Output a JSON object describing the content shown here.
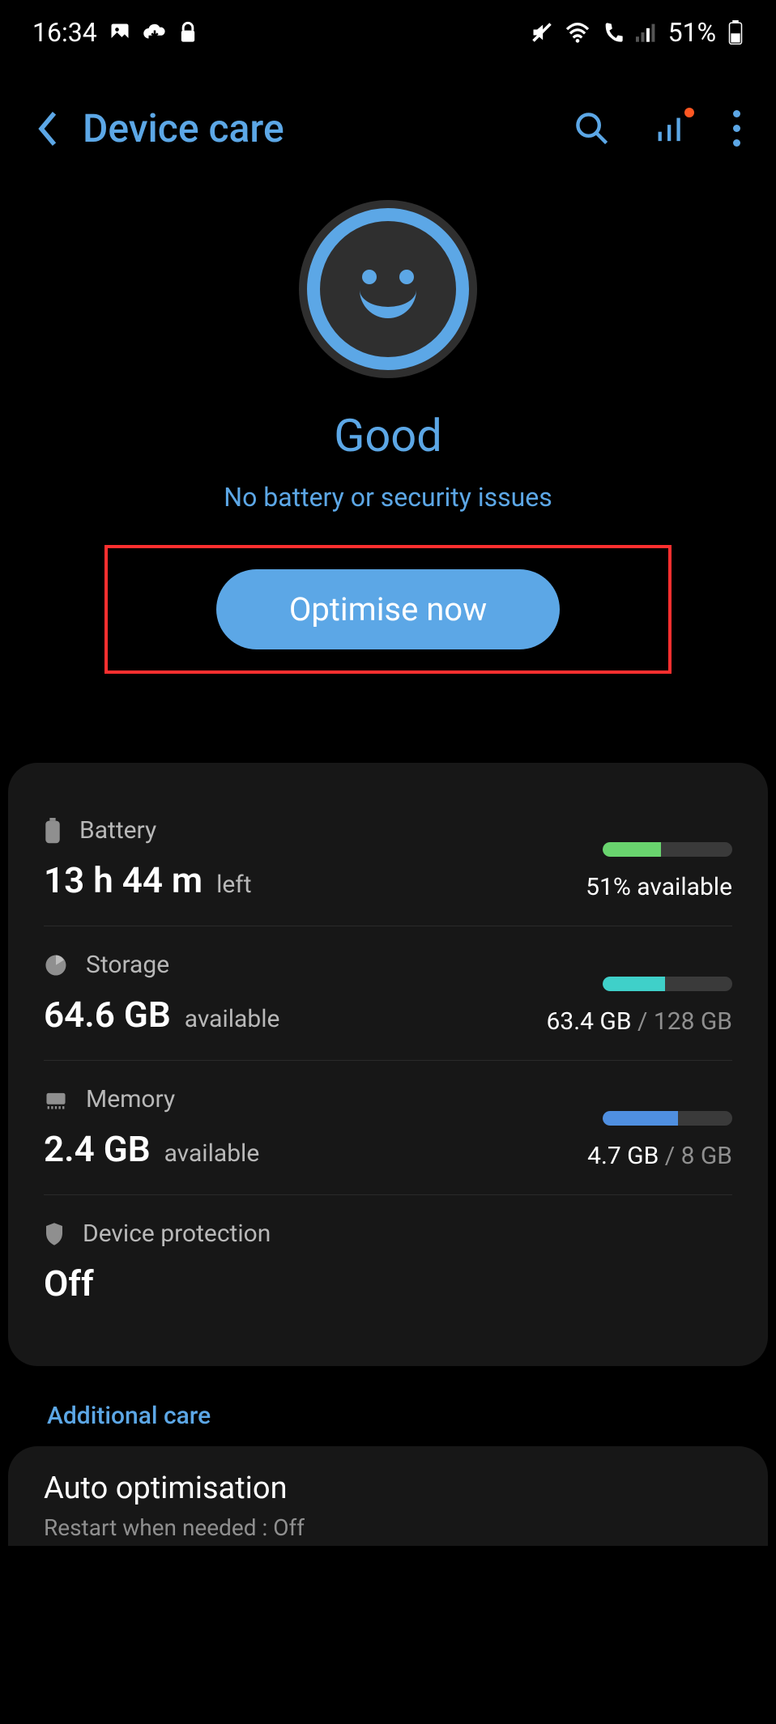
{
  "statusbar": {
    "time": "16:34",
    "battery_text": "51%"
  },
  "header": {
    "title": "Device care"
  },
  "hero": {
    "status_label": "Good",
    "status_sub": "No battery or security issues",
    "optimise_label": "Optimise now"
  },
  "rows": {
    "battery": {
      "label": "Battery",
      "value": "13 h 44 m",
      "suffix": "left",
      "right": "51% available",
      "fill_color": "#69d46e",
      "fill_pct": 45
    },
    "storage": {
      "label": "Storage",
      "value": "64.6 GB",
      "suffix": "available",
      "right_used": "63.4 GB",
      "right_total": "128 GB",
      "fill_color": "#3fd0c9",
      "fill_pct": 48
    },
    "memory": {
      "label": "Memory",
      "value": "2.4 GB",
      "suffix": "available",
      "right_used": "4.7 GB",
      "right_total": "8 GB",
      "fill_color": "#4f8fe0",
      "fill_pct": 58
    },
    "protection": {
      "label": "Device protection",
      "value": "Off"
    }
  },
  "additional": {
    "heading": "Additional care",
    "auto_title": "Auto optimisation",
    "auto_sub": "Restart when needed : Off"
  }
}
